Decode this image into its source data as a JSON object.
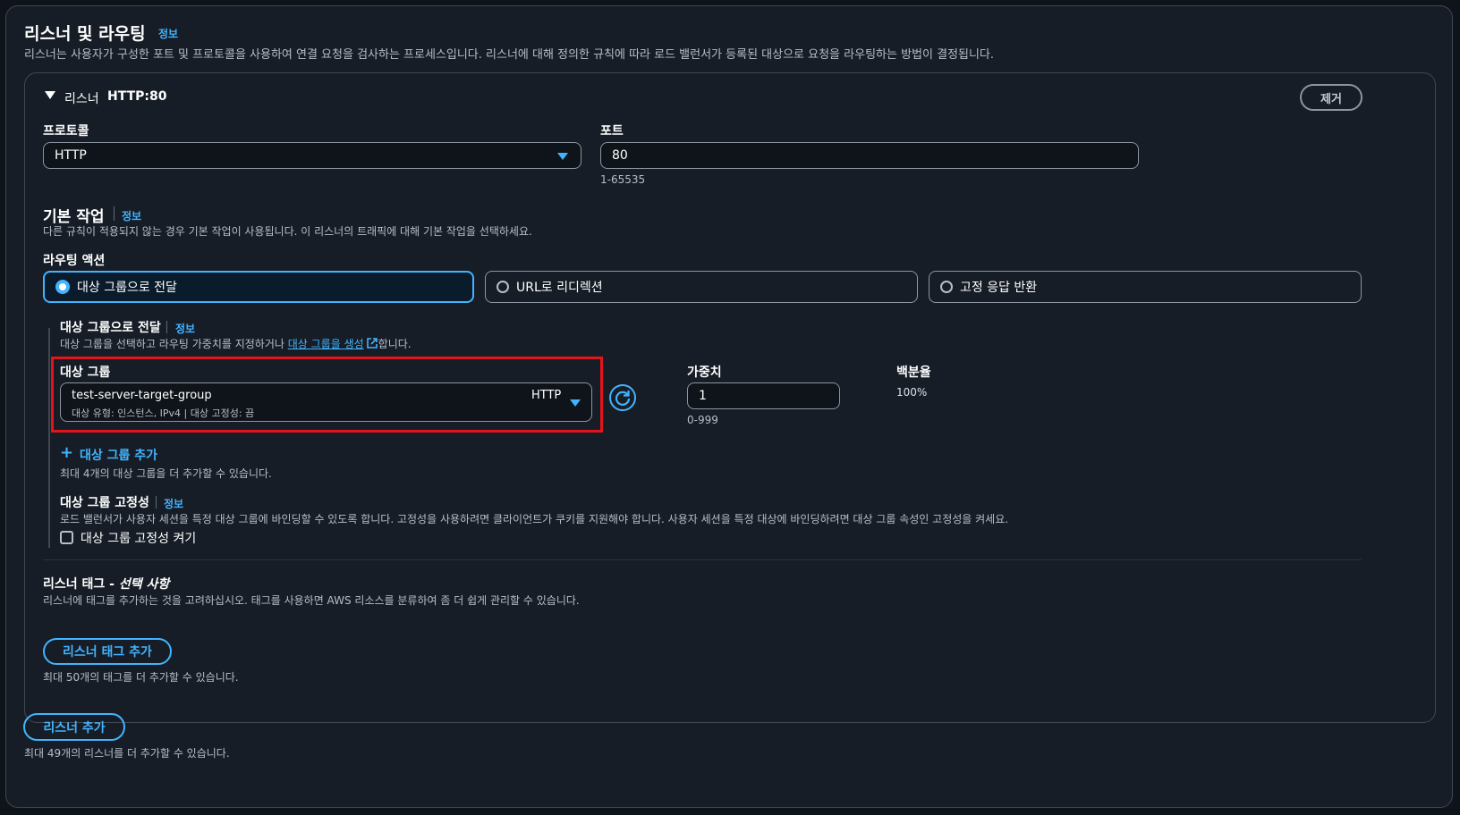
{
  "section": {
    "title": "리스너 및 라우팅",
    "info": "정보",
    "description": "리스너는 사용자가 구성한 포트 및 프로토콜을 사용하여 연결 요청을 검사하는 프로세스입니다. 리스너에 대해 정의한 규칙에 따라 로드 밸런서가 등록된 대상으로 요청을 라우팅하는 방법이 결정됩니다."
  },
  "listener": {
    "label": "리스너",
    "name": "HTTP:80",
    "remove_button": "제거",
    "protocol_label": "프로토콜",
    "protocol_value": "HTTP",
    "port_label": "포트",
    "port_value": "80",
    "port_hint": "1-65535"
  },
  "default_action": {
    "title": "기본 작업",
    "info": "정보",
    "description": "다른 규칙이 적용되지 않는 경우 기본 작업이 사용됩니다. 이 리스너의 트래픽에 대해 기본 작업을 선택하세요.",
    "routing_label": "라우팅 액션",
    "options": [
      "대상 그룹으로 전달",
      "URL로 리디렉션",
      "고정 응답 반환"
    ],
    "selected": "대상 그룹으로 전달"
  },
  "forward": {
    "title": "대상 그룹으로 전달",
    "info": "정보",
    "desc_before": "대상 그룹을 선택하고 라우팅 가중치를 지정하거나 ",
    "desc_link": "대상 그룹을 생성",
    "desc_after": "합니다.",
    "target_group_label": "대상 그룹",
    "target_group_name": "test-server-target-group",
    "target_group_protocol": "HTTP",
    "target_group_detail": "대상 유형: 인스턴스, IPv4 | 대상 고정성: 끔",
    "weight_label": "가중치",
    "weight_value": "1",
    "weight_hint": "0-999",
    "percent_label": "백분율",
    "percent_value": "100%",
    "add_group": "대상 그룹 추가",
    "add_group_hint": "최대 4개의 대상 그룹을 더 추가할 수 있습니다.",
    "stickiness_title": "대상 그룹 고정성",
    "stickiness_info": "정보",
    "stickiness_desc": "로드 밸런서가 사용자 세션을 특정 대상 그룹에 바인딩할 수 있도록 합니다. 고정성을 사용하려면 클라이언트가 쿠키를 지원해야 합니다. 사용자 세션을 특정 대상에 바인딩하려면 대상 그룹 속성인 고정성을 켜세요.",
    "stickiness_checkbox": "대상 그룹 고정성 켜기"
  },
  "tags": {
    "title": "리스너 태그 - ",
    "title_optional": "선택 사항",
    "description": "리스너에 태그를 추가하는 것을 고려하십시오. 태그를 사용하면 AWS 리소스를 분류하여 좀 더 쉽게 관리할 수 있습니다.",
    "add_button": "리스너 태그 추가",
    "hint": "최대 50개의 태그를 더 추가할 수 있습니다."
  },
  "footer": {
    "add_listener": "리스너 추가",
    "hint": "최대 49개의 리스너를 더 추가할 수 있습니다."
  },
  "colors": {
    "accent": "#42b4ff",
    "highlight": "#e5131b",
    "background": "#161d26"
  }
}
